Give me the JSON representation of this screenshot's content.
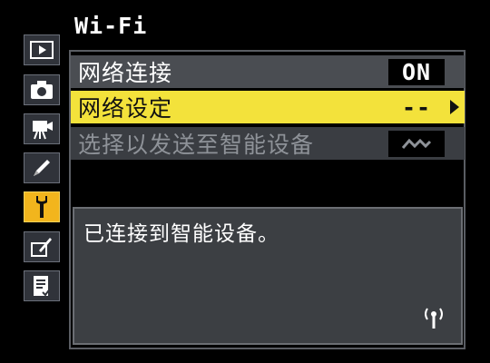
{
  "title": "Wi-Fi",
  "sidebar": {
    "items": [
      {
        "name": "playback-icon"
      },
      {
        "name": "camera-icon"
      },
      {
        "name": "movie-icon"
      },
      {
        "name": "pencil-icon"
      },
      {
        "name": "wrench-icon",
        "active": true
      },
      {
        "name": "retouch-icon"
      },
      {
        "name": "my-menu-icon"
      }
    ]
  },
  "menu": {
    "items": [
      {
        "label": "网络连接",
        "value": "ON"
      },
      {
        "label": "网络设定",
        "value": "--"
      },
      {
        "label": "选择以发送至智能设备",
        "value": ""
      }
    ]
  },
  "message": "已连接到智能设备。",
  "colors": {
    "highlight": "#f3e23b",
    "active_tab": "#f2b51d",
    "panel": "#3c3f43"
  }
}
